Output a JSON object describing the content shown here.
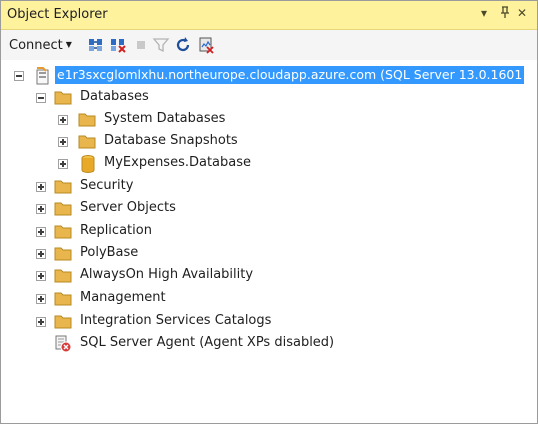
{
  "window": {
    "title": "Object Explorer",
    "controls": {
      "dropdown": "▾",
      "pin": "ᵱ",
      "close": "✕"
    }
  },
  "toolbar": {
    "connect_label": "Connect",
    "icons": [
      "connect-icon",
      "disconnect-icon",
      "stop-icon",
      "filter-icon",
      "refresh-icon",
      "activity-monitor-icon"
    ]
  },
  "tree": {
    "server": "e1r3sxcglomlxhu.northeurope.cloudapp.azure.com (SQL Server 13.0.1601",
    "databases": "Databases",
    "system_databases": "System Databases",
    "database_snapshots": "Database Snapshots",
    "my_db": "MyExpenses.Database",
    "security": "Security",
    "server_objects": "Server Objects",
    "replication": "Replication",
    "polybase": "PolyBase",
    "alwayson": "AlwaysOn High Availability",
    "management": "Management",
    "integration_services": "Integration Services Catalogs",
    "sql_agent": "SQL Server Agent (Agent XPs disabled)"
  },
  "colors": {
    "title_bg": "#fff29d",
    "selection": "#3399ff",
    "folder": "#e8b64c"
  }
}
